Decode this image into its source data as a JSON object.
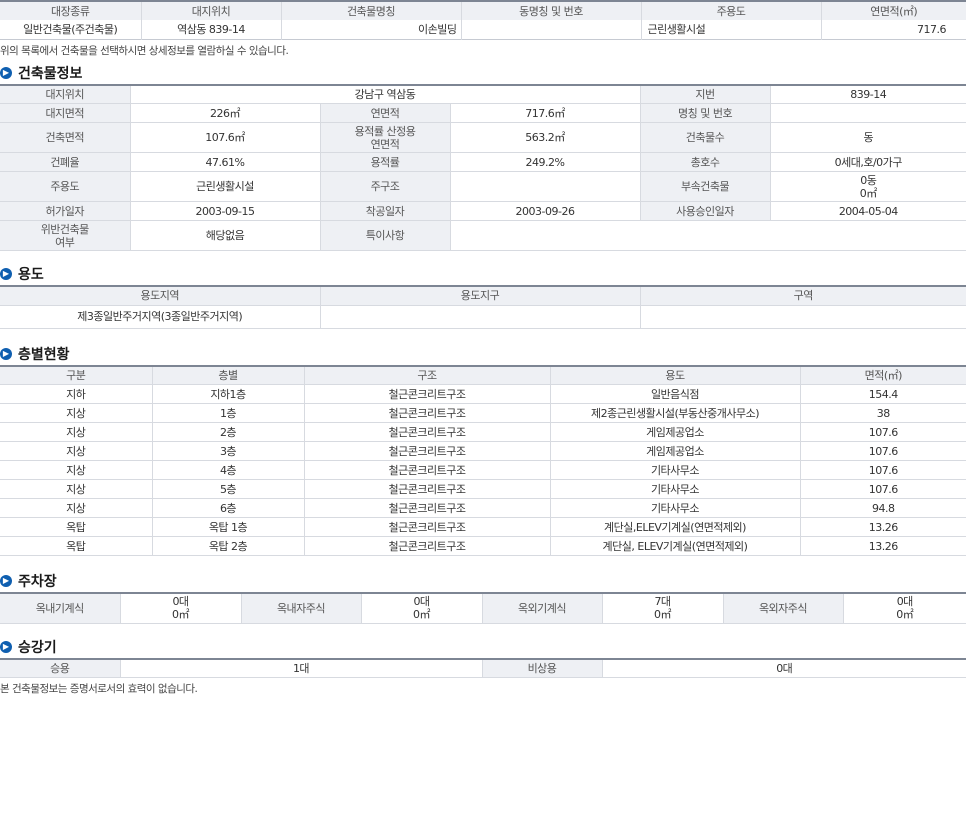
{
  "top": {
    "headers": [
      "대장종류",
      "대지위치",
      "건축물명칭",
      "동명칭 및 번호",
      "주용도",
      "연면적(㎡)"
    ],
    "row": [
      "일반건축물(주건축물)",
      "역삼동 839-14",
      "이손빌딩",
      "",
      "근린생활시설",
      "717.6"
    ]
  },
  "note": "위의 목록에서 건축물을 선택하시면 상세정보를 열람하실 수 있습니다.",
  "building": {
    "title": "건축물정보",
    "rows": [
      [
        {
          "k": "대지위치"
        },
        {
          "v": "강남구 역삼동",
          "span": 3
        },
        {
          "k": "지번"
        },
        {
          "v": "839-14"
        }
      ],
      [
        {
          "k": "대지면적"
        },
        {
          "v": "226㎡"
        },
        {
          "k": "연면적"
        },
        {
          "v": "717.6㎡"
        },
        {
          "k": "명칭 및 번호"
        },
        {
          "v": ""
        }
      ],
      [
        {
          "k": "건축면적"
        },
        {
          "v": "107.6㎡"
        },
        {
          "k": "용적률 산정용\n연면적"
        },
        {
          "v": "563.2㎡"
        },
        {
          "k": "건축물수"
        },
        {
          "v": "동"
        }
      ],
      [
        {
          "k": "건폐율"
        },
        {
          "v": "47.61%"
        },
        {
          "k": "용적률"
        },
        {
          "v": "249.2%"
        },
        {
          "k": "총호수"
        },
        {
          "v": "0세대,호/0가구"
        }
      ],
      [
        {
          "k": "주용도"
        },
        {
          "v": "근린생활시설"
        },
        {
          "k": "주구조"
        },
        {
          "v": ""
        },
        {
          "k": "부속건축물"
        },
        {
          "v": "0동\n0㎡"
        }
      ],
      [
        {
          "k": "허가일자"
        },
        {
          "v": "2003-09-15"
        },
        {
          "k": "착공일자"
        },
        {
          "v": "2003-09-26"
        },
        {
          "k": "사용승인일자"
        },
        {
          "v": "2004-05-04"
        }
      ],
      [
        {
          "k": "위반건축물\n여부"
        },
        {
          "v": "해당없음"
        },
        {
          "k": "특이사항"
        },
        {
          "v": "",
          "span": 3
        }
      ]
    ]
  },
  "usage": {
    "title": "용도",
    "headers": [
      "용도지역",
      "용도지구",
      "구역"
    ],
    "row": [
      "제3종일반주거지역(3종일반주거지역)",
      "",
      ""
    ]
  },
  "floors": {
    "title": "층별현황",
    "headers": [
      "구분",
      "층별",
      "구조",
      "용도",
      "면적(㎡)"
    ],
    "rows": [
      [
        "지하",
        "지하1층",
        "철근콘크리트구조",
        "일반음식점",
        "154.4"
      ],
      [
        "지상",
        "1층",
        "철근콘크리트구조",
        "제2종근린생활시설(부동산중개사무소)",
        "38"
      ],
      [
        "지상",
        "2층",
        "철근콘크리트구조",
        "게임제공업소",
        "107.6"
      ],
      [
        "지상",
        "3층",
        "철근콘크리트구조",
        "게임제공업소",
        "107.6"
      ],
      [
        "지상",
        "4층",
        "철근콘크리트구조",
        "기타사무소",
        "107.6"
      ],
      [
        "지상",
        "5층",
        "철근콘크리트구조",
        "기타사무소",
        "107.6"
      ],
      [
        "지상",
        "6층",
        "철근콘크리트구조",
        "기타사무소",
        "94.8"
      ],
      [
        "옥탑",
        "옥탑 1층",
        "철근콘크리트구조",
        "계단실,ELEV기계실(연면적제외)",
        "13.26"
      ],
      [
        "옥탑",
        "옥탑 2층",
        "철근콘크리트구조",
        "계단실, ELEV기계실(연면적제외)",
        "13.26"
      ]
    ]
  },
  "parking": {
    "title": "주차장",
    "items": [
      {
        "label": "옥내기계식",
        "count": "0대",
        "area": "0㎡"
      },
      {
        "label": "옥내자주식",
        "count": "0대",
        "area": "0㎡"
      },
      {
        "label": "옥외기계식",
        "count": "7대",
        "area": "0㎡"
      },
      {
        "label": "옥외자주식",
        "count": "0대",
        "area": "0㎡"
      }
    ]
  },
  "elevator": {
    "title": "승강기",
    "items": [
      {
        "label": "승용",
        "value": "1대"
      },
      {
        "label": "비상용",
        "value": "0대"
      }
    ]
  },
  "footer": "본 건축물정보는 증명서로서의 효력이 없습니다.",
  "icon": "chevron-right-circle-icon"
}
